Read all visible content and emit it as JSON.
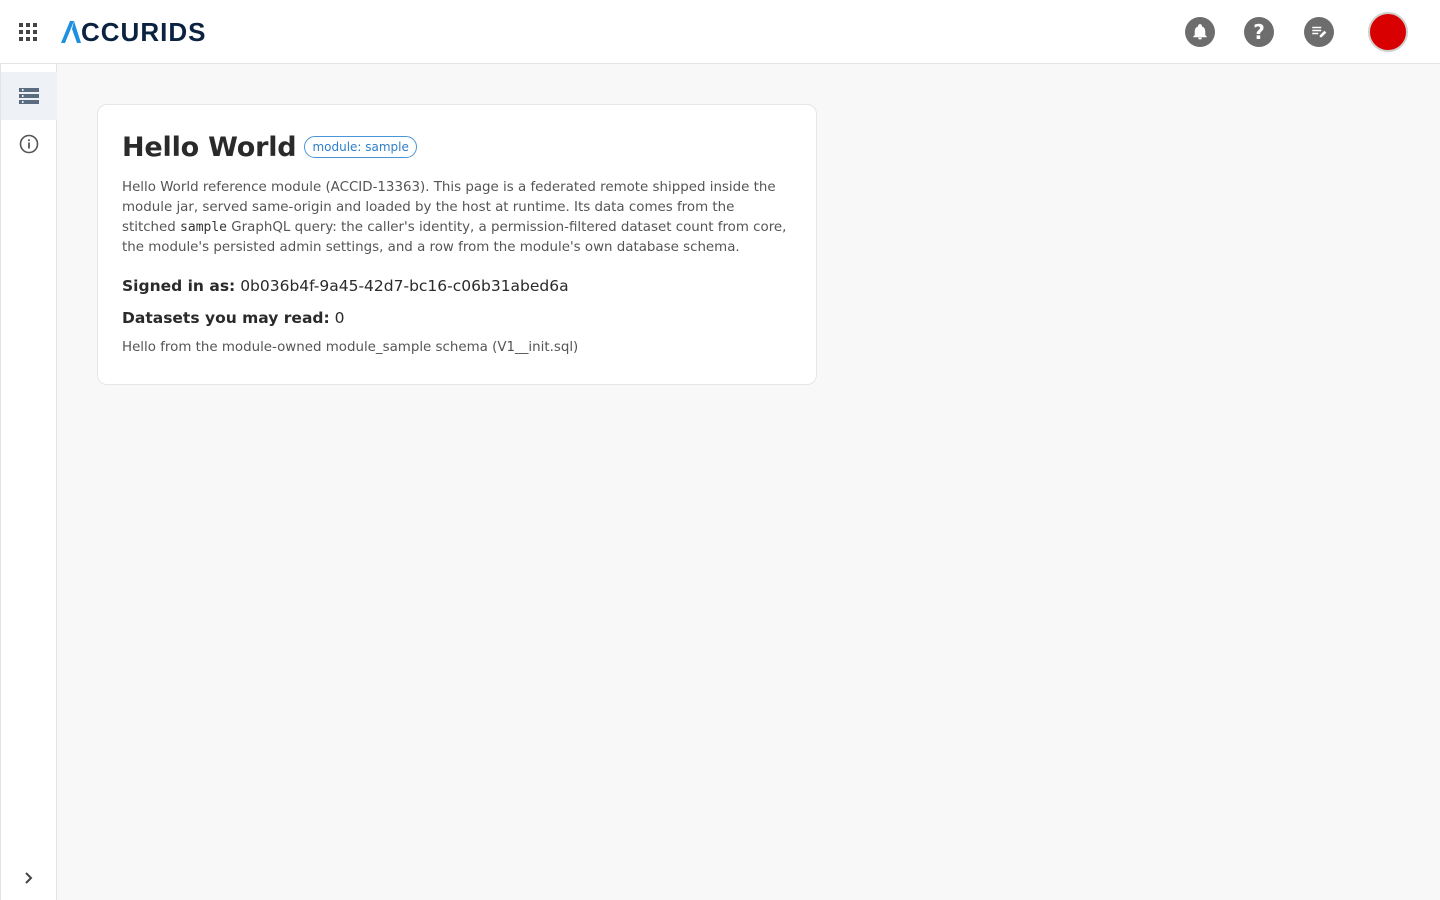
{
  "header": {
    "brand": "CCURIDS",
    "brand_full": "ACCURIDS",
    "icons": [
      "apps-grid-icon",
      "bell-icon",
      "help-icon",
      "edit-notes-icon"
    ],
    "avatar_color": "#d80000"
  },
  "sidebar": {
    "items": [
      {
        "icon": "list-icon",
        "active": true
      },
      {
        "icon": "info-icon",
        "active": false
      }
    ],
    "expand_icon": "chevron-right-icon"
  },
  "card": {
    "title": "Hello World",
    "chip": "module: sample",
    "desc_part1": "Hello World reference module (ACCID-13363). This page is a federated remote shipped inside the module jar, served same-origin and loaded by the host at runtime. Its data comes from the stitched ",
    "desc_code": "sample",
    "desc_part2": " GraphQL query: the caller's identity, a permission-filtered dataset count from core, the module's persisted admin settings, and a row from the module's own database schema.",
    "signed_in_label": "Signed in as:",
    "signed_in_value": "0b036b4f-9a45-42d7-bc16-c06b31abed6a",
    "datasets_label": "Datasets you may read:",
    "datasets_value": "0",
    "schema_note": "Hello from the module-owned module_sample schema (V1__init.sql)"
  },
  "colors": {
    "brand_dark": "#0b2341",
    "brand_blue": "#1f8fe0",
    "chip": "#2f7fc9",
    "avatar": "#d80000"
  }
}
